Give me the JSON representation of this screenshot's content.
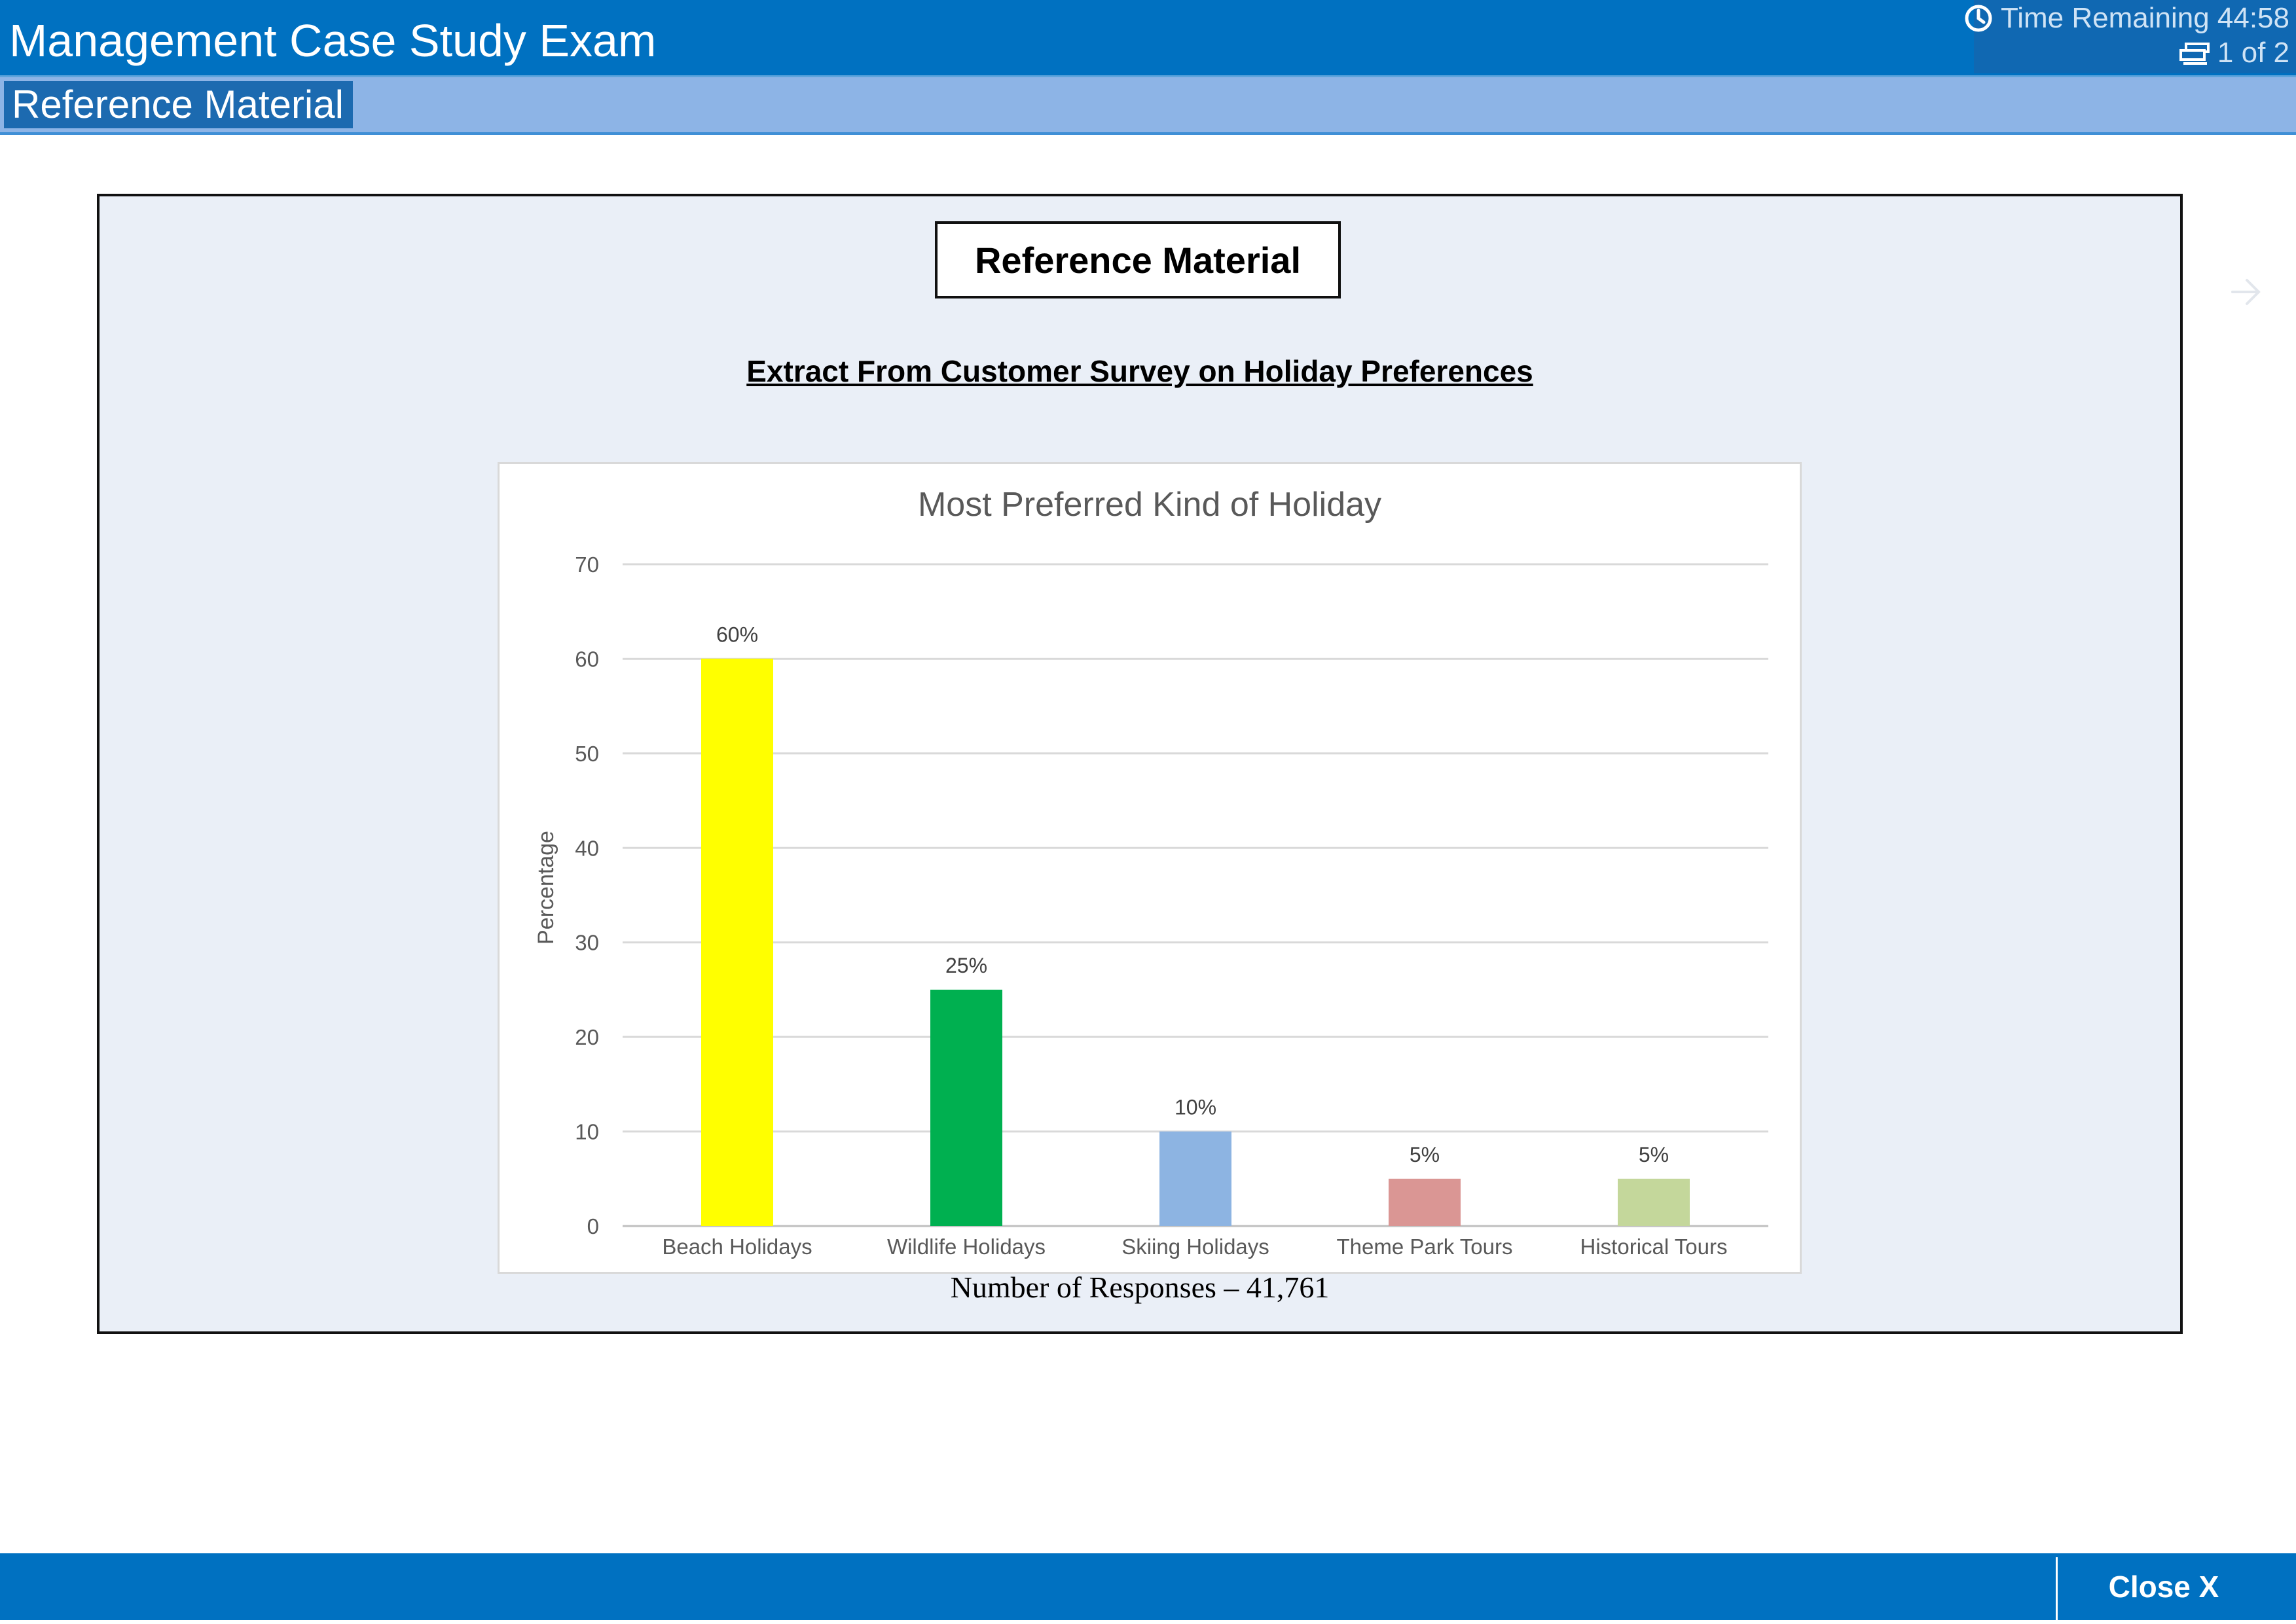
{
  "header": {
    "title": "Management Case Study Exam",
    "time_label": "Time Remaining 44:58",
    "page_indicator": "1 of 2",
    "section_tab": "Reference Material"
  },
  "panel": {
    "heading": "Reference Material",
    "extract_title": "Extract From Customer Survey on Holiday Preferences",
    "responses_note": "Number of Responses – 41,761"
  },
  "chart_data": {
    "type": "bar",
    "title": "Most Preferred Kind of Holiday",
    "xlabel": "",
    "ylabel": "Percentage",
    "categories": [
      "Beach Holidays",
      "Wildlife Holidays",
      "Skiing Holidays",
      "Theme Park Tours",
      "Historical Tours"
    ],
    "values": [
      60,
      25,
      10,
      5,
      5
    ],
    "data_labels": [
      "60%",
      "25%",
      "10%",
      "5%",
      "5%"
    ],
    "colors": [
      "#ffff00",
      "#00b050",
      "#8db4e2",
      "#da9694",
      "#c4d79b"
    ],
    "ylim": [
      0,
      70
    ],
    "yticks": [
      0,
      10,
      20,
      30,
      40,
      50,
      60,
      70
    ],
    "grid": true,
    "legend": "none"
  },
  "footer": {
    "close_label": "Close X"
  },
  "colors": {
    "header_blue": "#0071c1",
    "subbar_blue": "#8db4e6",
    "panel_bg": "#eaeff7"
  },
  "icons": {
    "timer": "clock-icon",
    "page": "pages-icon",
    "next": "arrow-right-icon"
  }
}
